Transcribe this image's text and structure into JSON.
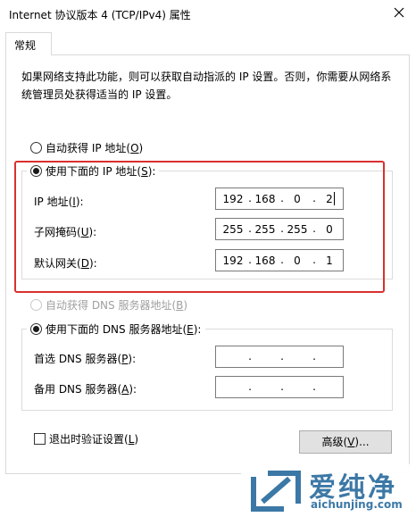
{
  "window": {
    "title": "Internet 协议版本 4 (TCP/IPv4) 属性"
  },
  "tab": {
    "label": "常规"
  },
  "description": "如果网络支持此功能，则可以获取自动指派的 IP 设置。否则，你需要从网络系统管理员处获得适当的 IP 设置。",
  "ip_section": {
    "auto_option": {
      "text": "自动获得 IP 地址(",
      "key": "O",
      "end": ")",
      "selected": false
    },
    "manual_option": {
      "text": "使用下面的 IP 地址(",
      "key": "S",
      "end": "):",
      "selected": true
    },
    "fields": [
      {
        "label": "IP 地址(",
        "key": "I",
        "end": "):",
        "octets": [
          "192",
          "168",
          "0",
          "2"
        ]
      },
      {
        "label": "子网掩码(",
        "key": "U",
        "end": "):",
        "octets": [
          "255",
          "255",
          "255",
          "0"
        ]
      },
      {
        "label": "默认网关(",
        "key": "D",
        "end": "):",
        "octets": [
          "192",
          "168",
          "0",
          "1"
        ]
      }
    ]
  },
  "dns_section": {
    "auto_option": {
      "text": "自动获得 DNS 服务器地址(",
      "key": "B",
      "end": ")",
      "selected": false,
      "disabled": true
    },
    "manual_option": {
      "text": "使用下面的 DNS 服务器地址(",
      "key": "E",
      "end": "):",
      "selected": true
    },
    "fields": [
      {
        "label": "首选 DNS 服务器(",
        "key": "P",
        "end": "):",
        "octets": [
          "",
          "",
          "",
          ""
        ]
      },
      {
        "label": "备用 DNS 服务器(",
        "key": "A",
        "end": "):",
        "octets": [
          "",
          "",
          "",
          ""
        ]
      }
    ]
  },
  "validate": {
    "text": "退出时验证设置(",
    "key": "L",
    "end": ")",
    "checked": false
  },
  "advanced_button": {
    "text": "高级(",
    "key": "V",
    "end": ")..."
  },
  "watermark": {
    "text": "爱纯净",
    "url": "aichunjing.com"
  },
  "colors": {
    "highlight_border": "#d9302f",
    "watermark": "#3c78a6"
  }
}
